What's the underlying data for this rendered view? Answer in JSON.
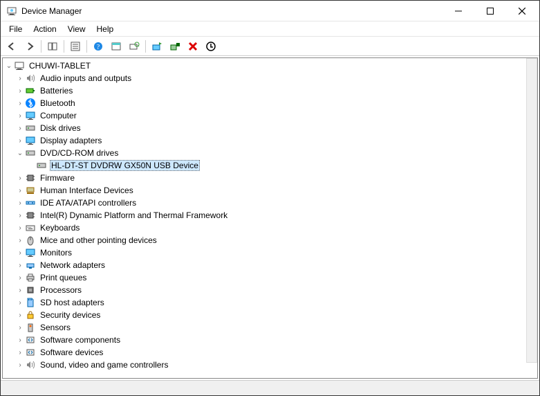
{
  "window": {
    "title": "Device Manager"
  },
  "menu": {
    "file": "File",
    "action": "Action",
    "view": "View",
    "help": "Help"
  },
  "tree": {
    "root": {
      "label": "CHUWI-TABLET"
    },
    "items": [
      {
        "label": "Audio inputs and outputs",
        "icon": "speaker"
      },
      {
        "label": "Batteries",
        "icon": "battery"
      },
      {
        "label": "Bluetooth",
        "icon": "bluetooth"
      },
      {
        "label": "Computer",
        "icon": "monitor"
      },
      {
        "label": "Disk drives",
        "icon": "disk"
      },
      {
        "label": "Display adapters",
        "icon": "monitor"
      },
      {
        "label": "DVD/CD-ROM drives",
        "icon": "disk",
        "expanded": true
      },
      {
        "label": "Firmware",
        "icon": "chip"
      },
      {
        "label": "Human Interface Devices",
        "icon": "hid"
      },
      {
        "label": "IDE ATA/ATAPI controllers",
        "icon": "ide"
      },
      {
        "label": "Intel(R) Dynamic Platform and Thermal Framework",
        "icon": "chip"
      },
      {
        "label": "Keyboards",
        "icon": "keyboard"
      },
      {
        "label": "Mice and other pointing devices",
        "icon": "mouse"
      },
      {
        "label": "Monitors",
        "icon": "monitor"
      },
      {
        "label": "Network adapters",
        "icon": "net"
      },
      {
        "label": "Print queues",
        "icon": "printer"
      },
      {
        "label": "Processors",
        "icon": "cpu"
      },
      {
        "label": "SD host adapters",
        "icon": "sd"
      },
      {
        "label": "Security devices",
        "icon": "lock"
      },
      {
        "label": "Sensors",
        "icon": "sensor"
      },
      {
        "label": "Software components",
        "icon": "sw"
      },
      {
        "label": "Software devices",
        "icon": "sw"
      },
      {
        "label": "Sound, video and game controllers",
        "icon": "speaker"
      }
    ],
    "dvd_child": {
      "label": "HL-DT-ST DVDRW  GX50N USB Device"
    }
  }
}
